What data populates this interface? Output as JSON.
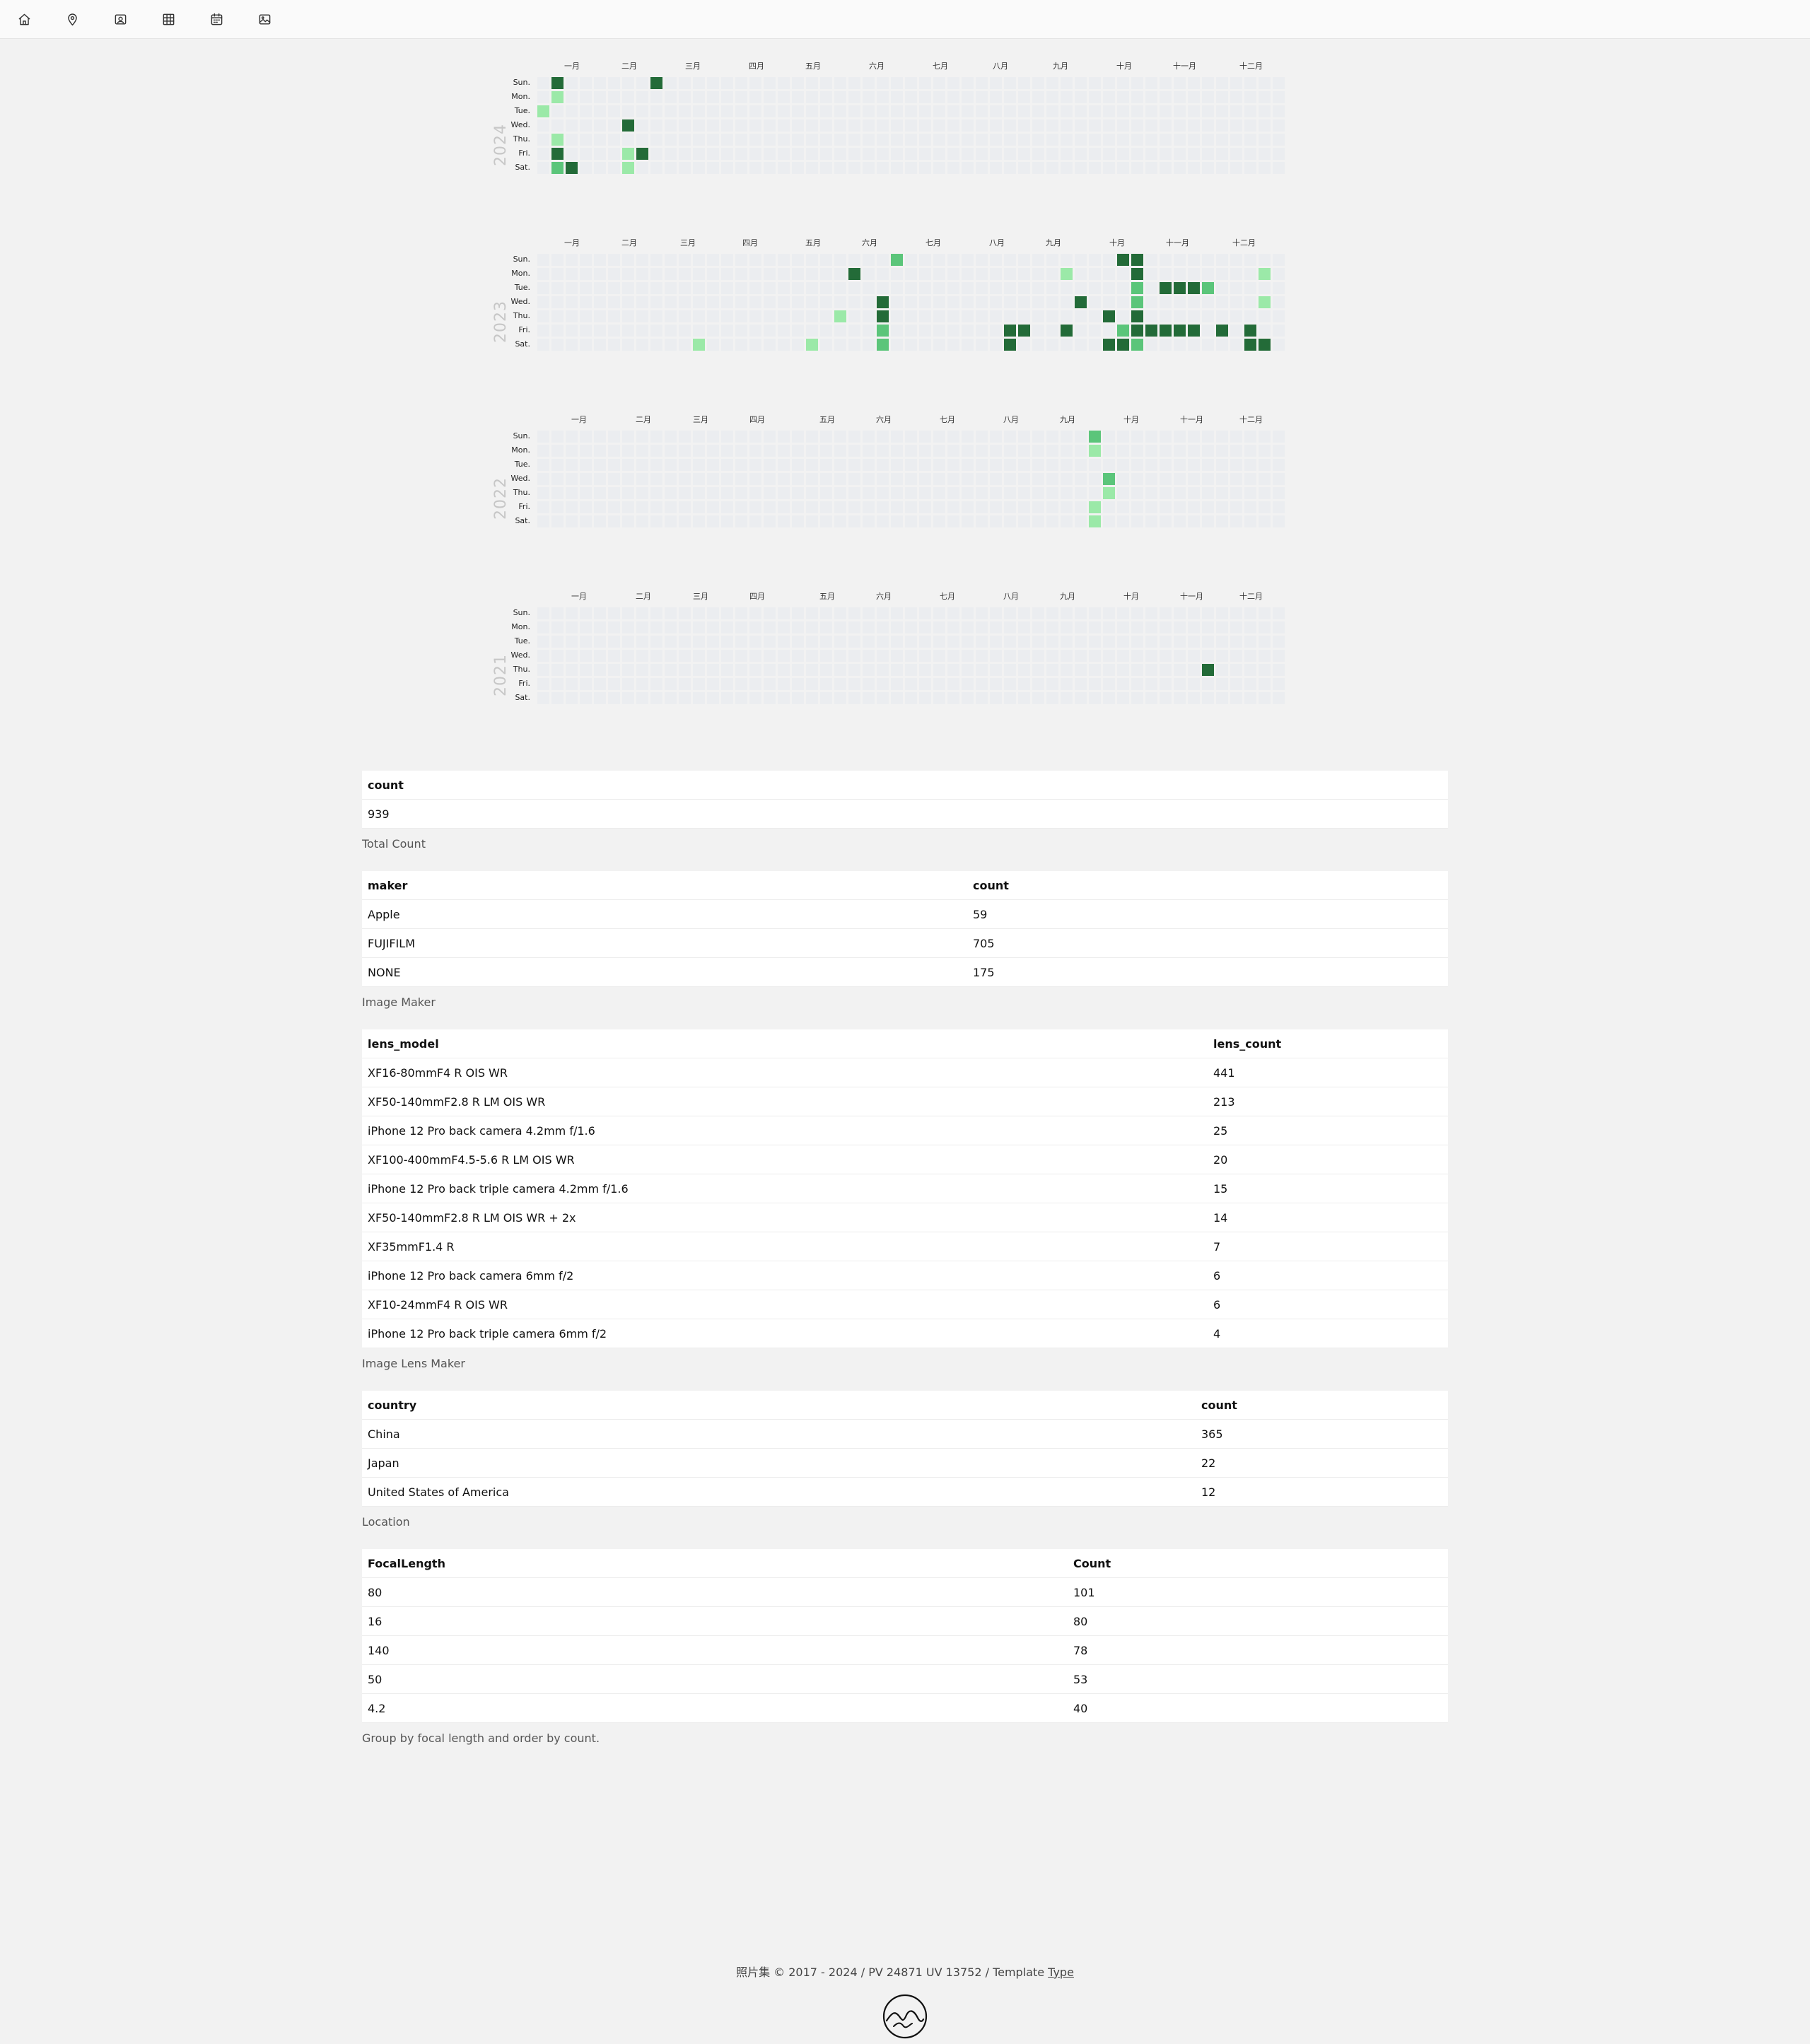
{
  "nav": {
    "items": [
      {
        "name": "home-icon"
      },
      {
        "name": "location-pin-icon"
      },
      {
        "name": "album-icon"
      },
      {
        "name": "grid-icon"
      },
      {
        "name": "calendar-icon"
      },
      {
        "name": "image-icon"
      }
    ]
  },
  "calendar": {
    "day_labels": [
      "Sun.",
      "Mon.",
      "Tue.",
      "Wed.",
      "Thu.",
      "Fri.",
      "Sat."
    ],
    "month_labels": [
      "一月",
      "二月",
      "三月",
      "四月",
      "五月",
      "六月",
      "七月",
      "八月",
      "九月",
      "十月",
      "十一月",
      "十二月"
    ],
    "colors": {
      "empty": "#ebedf0",
      "level1": "#9be9a8",
      "level2": "#5bc57a",
      "level3": "#236b38"
    },
    "years": [
      {
        "year": "2024",
        "cells": [
          [
            1,
            0,
            3
          ],
          [
            1,
            1,
            1
          ],
          [
            0,
            2,
            1
          ],
          [
            1,
            4,
            1
          ],
          [
            1,
            5,
            3
          ],
          [
            1,
            6,
            2
          ],
          [
            2,
            6,
            3
          ],
          [
            6,
            3,
            3
          ],
          [
            6,
            5,
            1
          ],
          [
            6,
            6,
            1
          ],
          [
            7,
            5,
            3
          ],
          [
            8,
            0,
            3
          ]
        ]
      },
      {
        "year": "2023",
        "cells": [
          [
            11,
            6,
            1
          ],
          [
            19,
            6,
            1
          ],
          [
            21,
            4,
            1
          ],
          [
            22,
            1,
            3
          ],
          [
            24,
            3,
            3
          ],
          [
            24,
            4,
            3
          ],
          [
            24,
            5,
            2
          ],
          [
            24,
            6,
            2
          ],
          [
            25,
            0,
            2
          ],
          [
            33,
            5,
            3
          ],
          [
            33,
            6,
            3
          ],
          [
            34,
            5,
            3
          ],
          [
            37,
            1,
            1
          ],
          [
            37,
            5,
            3
          ],
          [
            38,
            3,
            3
          ],
          [
            40,
            4,
            3
          ],
          [
            40,
            6,
            3
          ],
          [
            41,
            0,
            3
          ],
          [
            41,
            5,
            2
          ],
          [
            41,
            6,
            3
          ],
          [
            42,
            0,
            3
          ],
          [
            42,
            1,
            3
          ],
          [
            42,
            2,
            2
          ],
          [
            42,
            3,
            2
          ],
          [
            42,
            4,
            3
          ],
          [
            42,
            5,
            3
          ],
          [
            42,
            6,
            2
          ],
          [
            43,
            5,
            3
          ],
          [
            44,
            2,
            3
          ],
          [
            44,
            5,
            3
          ],
          [
            45,
            2,
            3
          ],
          [
            45,
            5,
            3
          ],
          [
            46,
            2,
            3
          ],
          [
            46,
            5,
            3
          ],
          [
            47,
            2,
            2
          ],
          [
            48,
            5,
            3
          ],
          [
            50,
            5,
            3
          ],
          [
            50,
            6,
            3
          ],
          [
            51,
            1,
            1
          ],
          [
            51,
            3,
            1
          ],
          [
            51,
            6,
            3
          ]
        ]
      },
      {
        "year": "2022",
        "cells": [
          [
            39,
            0,
            2
          ],
          [
            39,
            1,
            1
          ],
          [
            39,
            5,
            1
          ],
          [
            39,
            6,
            1
          ],
          [
            40,
            3,
            2
          ],
          [
            40,
            4,
            1
          ]
        ]
      },
      {
        "year": "2021",
        "cells": [
          [
            47,
            4,
            3
          ]
        ]
      }
    ]
  },
  "tables": [
    {
      "headers": [
        "count"
      ],
      "rows": [
        [
          "939"
        ]
      ],
      "caption": "Total Count"
    },
    {
      "headers": [
        "maker",
        "count"
      ],
      "rows": [
        [
          "Apple",
          "59"
        ],
        [
          "FUJIFILM",
          "705"
        ],
        [
          "NONE",
          "175"
        ]
      ],
      "caption": "Image Maker"
    },
    {
      "headers": [
        "lens_model",
        "lens_count"
      ],
      "rows": [
        [
          "XF16-80mmF4 R OIS WR",
          "441"
        ],
        [
          "XF50-140mmF2.8 R LM OIS WR",
          "213"
        ],
        [
          "iPhone 12 Pro back camera 4.2mm f/1.6",
          "25"
        ],
        [
          "XF100-400mmF4.5-5.6 R LM OIS WR",
          "20"
        ],
        [
          "iPhone 12 Pro back triple camera 4.2mm f/1.6",
          "15"
        ],
        [
          "XF50-140mmF2.8 R LM OIS WR + 2x",
          "14"
        ],
        [
          "XF35mmF1.4 R",
          "7"
        ],
        [
          "iPhone 12 Pro back camera 6mm f/2",
          "6"
        ],
        [
          "XF10-24mmF4 R OIS WR",
          "6"
        ],
        [
          "iPhone 12 Pro back triple camera 6mm f/2",
          "4"
        ]
      ],
      "caption": "Image Lens Maker"
    },
    {
      "headers": [
        "country",
        "count"
      ],
      "rows": [
        [
          "China",
          "365"
        ],
        [
          "Japan",
          "22"
        ],
        [
          "United States of America",
          "12"
        ]
      ],
      "caption": "Location"
    },
    {
      "headers": [
        "FocalLength",
        "Count"
      ],
      "rows": [
        [
          "80",
          "101"
        ],
        [
          "16",
          "80"
        ],
        [
          "140",
          "78"
        ],
        [
          "50",
          "53"
        ],
        [
          "4.2",
          "40"
        ]
      ],
      "caption": "Group by focal length and order by count."
    }
  ],
  "footer": {
    "text": "照片集 © 2017 - 2024 / PV 24871 UV 13752 / Template ",
    "link_label": "Type"
  }
}
